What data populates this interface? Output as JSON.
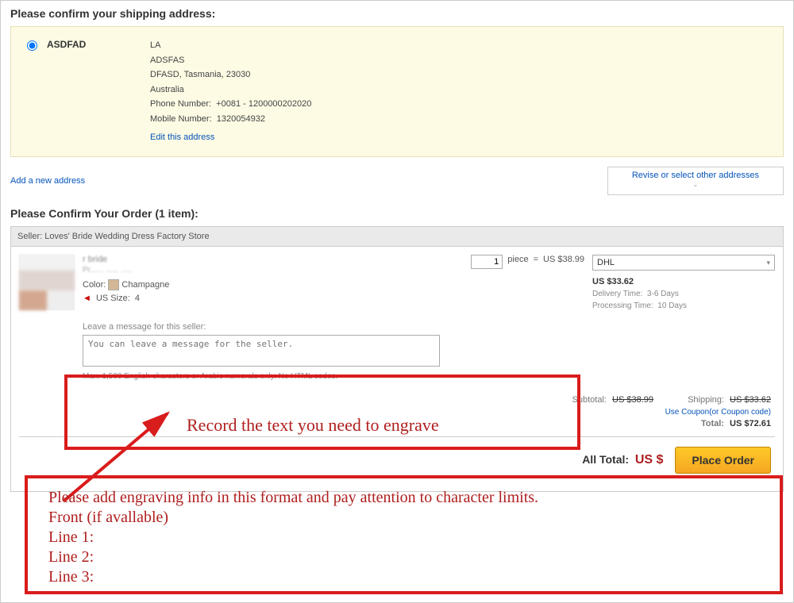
{
  "shipping": {
    "title": "Please confirm your shipping address:",
    "name": "ASDFAD",
    "line1": "LA",
    "line2": "ADSFAS",
    "line3": "DFASD, Tasmania, 23030",
    "country": "Australia",
    "phone_label": "Phone Number:",
    "phone": "+0081 - 1200000202020",
    "mobile_label": "Mobile Number:",
    "mobile": "1320054932",
    "edit": "Edit this address",
    "add_new": "Add a new address",
    "revise": "Revise or select other addresses"
  },
  "order": {
    "title": "Please Confirm Your Order (1 item):",
    "seller_label": "Seller:",
    "seller_name": "Loves' Bride Wedding Dress Factory Store",
    "prod_title_blur": "r                                                                           bride",
    "prod_sub_blur": "Pr...... ...... .....",
    "color_label": "Color:",
    "color_value": "Champagne",
    "size_label": "US Size:",
    "size_value": "4",
    "qty_value": "1",
    "piece": "piece",
    "eq": "=",
    "unit_price": "US $38.99",
    "ship_method": "DHL",
    "ship_price": "US $33.62",
    "delivery_label": "Delivery Time:",
    "delivery_value": "3-6 Days",
    "processing_label": "Processing Time:",
    "processing_value": "10 Days",
    "msg_label": "Leave a message for this seller:",
    "msg_placeholder": "You can leave a message for the seller.",
    "msg_hint": "Max. 1,500 English characters or Arabic numerals only. No HTML codes."
  },
  "totals": {
    "subtotal_label": "Subtotal:",
    "subtotal": "US $38.99",
    "shipping_label": "Shipping:",
    "shipping": "US $33.62",
    "coupon": "Use Coupon(or Coupon code)",
    "total_label": "Total:",
    "total": "US $72.61",
    "all_total_label": "All Total:",
    "all_total": "US $",
    "place_order": "Place Order"
  },
  "annotations": {
    "engrave": "Record the text you need to engrave",
    "format1": "Please add engraving info in this format and pay attention to character limits.",
    "format2": "Front (if avallable)",
    "line1": "Line 1:",
    "line2": "Line 2:",
    "line3": "Line 3:"
  }
}
